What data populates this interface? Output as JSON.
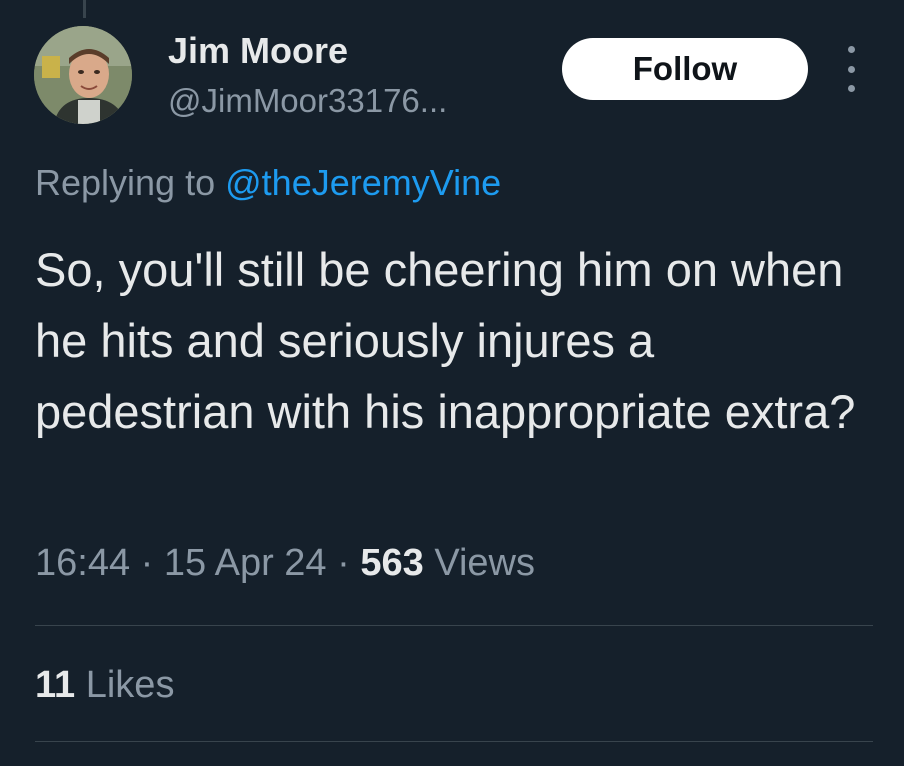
{
  "author": {
    "name": "Jim Moore",
    "handle": "@JimMoor33176..."
  },
  "actions": {
    "follow_label": "Follow",
    "more_icon": "more-vertical-icon"
  },
  "reply": {
    "prefix": "Replying to",
    "mention": "@theJeremyVine"
  },
  "tweet": {
    "text": "So, you'll still be cheering him on when he hits and seriously injures a pedestrian with his inappropriate extra?"
  },
  "meta": {
    "time": "16:44",
    "separator": "·",
    "date": "15 Apr 24",
    "views_count": "563",
    "views_label": "Views"
  },
  "stats": {
    "likes_count": "11",
    "likes_label": "Likes"
  },
  "colors": {
    "background": "#15202b",
    "text": "#e7e9ea",
    "secondary_text": "#8b98a5",
    "link": "#1d9bf0",
    "divider": "#38444d"
  }
}
